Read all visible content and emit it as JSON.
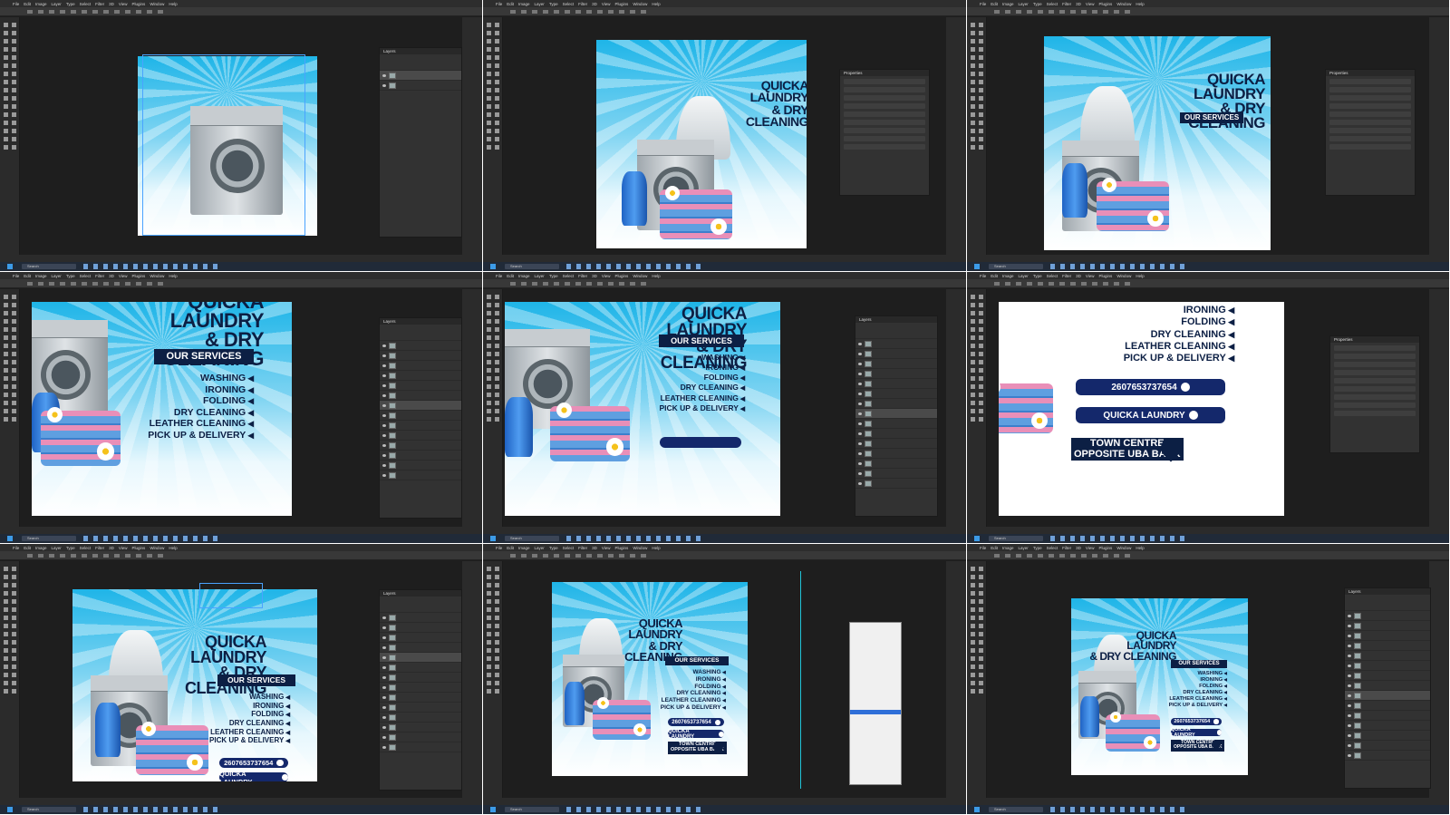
{
  "menu": [
    "File",
    "Edit",
    "Image",
    "Layer",
    "Type",
    "Select",
    "Filter",
    "3D",
    "View",
    "Plugins",
    "Window",
    "Help"
  ],
  "taskbar": {
    "search": "Search"
  },
  "design": {
    "title_line1": "QUICKA LAUNDRY",
    "title_line2": "& DRY CLEANING",
    "services_label": "OUR SERVICES",
    "services": [
      "WASHING",
      "IRONING",
      "FOLDING",
      "DRY CLEANING",
      "LEATHER CLEANING",
      "PICK UP & DELIVERY"
    ],
    "phone": "2607653737654",
    "facebook": "QUICKA LAUNDRY",
    "location_line1": "TOWN CENTRE",
    "location_line2": "OPPOSITE UBA BANK"
  },
  "colors": {
    "navy": "#0c1f44",
    "pill": "#14286b",
    "sky": "#1fb5e8",
    "ps_dark": "#1e1e1e"
  },
  "icons": [
    "whatsapp-icon",
    "facebook-icon",
    "location-pin-icon",
    "eye-icon",
    "windows-icon"
  ],
  "panels": {
    "layers": "Layers",
    "properties": "Properties"
  }
}
